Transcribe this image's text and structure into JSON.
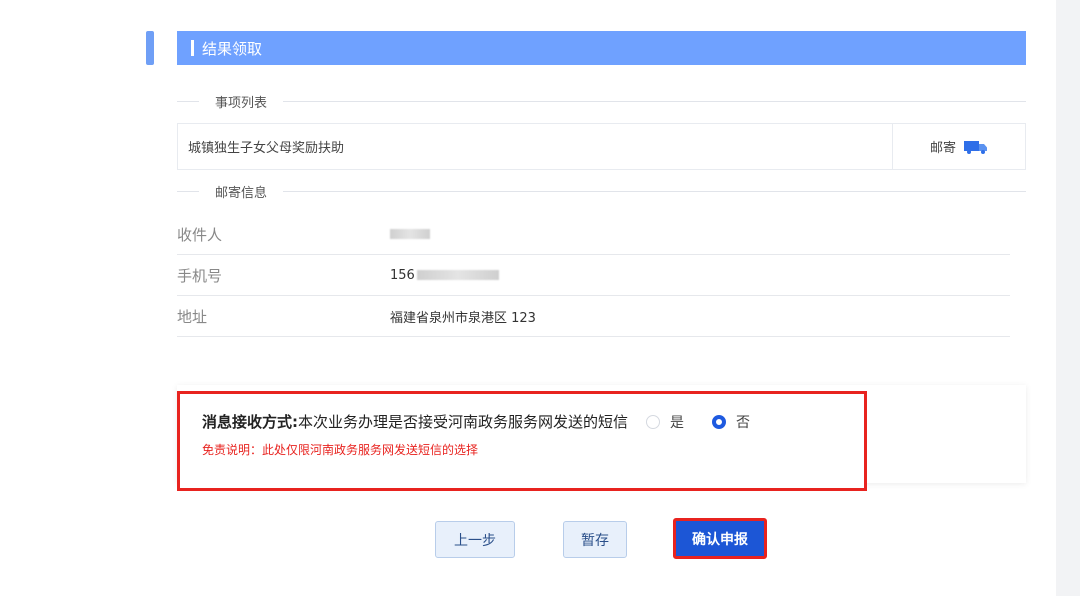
{
  "section": {
    "title": "结果领取"
  },
  "items_divider": {
    "label": "事项列表"
  },
  "items": [
    {
      "name": "城镇独生子女父母奖励扶助",
      "delivery_method": "邮寄",
      "delivery_icon": "truck-icon"
    }
  ],
  "mail_divider": {
    "label": "邮寄信息"
  },
  "mail_info": {
    "recipient_label": "收件人",
    "phone_label": "手机号",
    "phone_value_visible": "156",
    "address_label": "地址",
    "address_value": "福建省泉州市泉港区 123"
  },
  "notice": {
    "label": "消息接收方式:",
    "question": "本次业务办理是否接受河南政务服务网发送的短信",
    "option_yes": "是",
    "option_no": "否",
    "selected": "否",
    "disclaimer": "免责说明：此处仅限河南政务服务网发送短信的选择"
  },
  "buttons": {
    "prev": "上一步",
    "save": "暂存",
    "submit": "确认申报"
  },
  "colors": {
    "header_bg": "#6fa1ff",
    "primary": "#1c56d6",
    "highlight_red": "#e8231f"
  }
}
